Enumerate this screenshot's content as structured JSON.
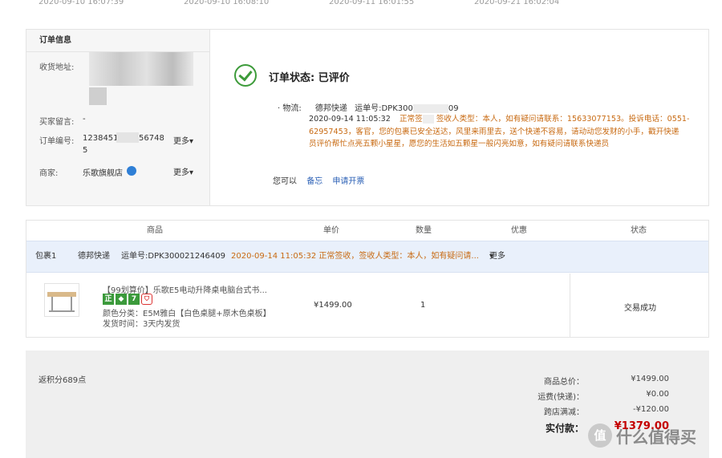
{
  "timeline": [
    "2020-09-10 16:07:39",
    "2020-09-10 16:08:10",
    "2020-09-11 16:01:55",
    "2020-09-21 16:02:04"
  ],
  "order_info": {
    "heading": "订单信息",
    "address_label": "收货地址:",
    "buyer_note_label": "买家留言:",
    "buyer_note": "-",
    "order_no_label": "订单编号:",
    "order_no_a": "1238451",
    "order_no_b": "56748",
    "order_no_c": "5",
    "more": "更多",
    "merchant_label": "商家:",
    "merchant": "乐歌旗舰店",
    "merchant_more": "更多"
  },
  "status": {
    "title": "订单状态: 已评价",
    "logistics_label": "· 物流:",
    "carrier": "德邦快递",
    "waybill_label": "运单号:DPK300",
    "waybill_tail": "09",
    "time": "2020-09-14 11:05:32",
    "detail_head": "正常签",
    "detail_a": "签收人类型：本人，如有疑问请联系：15633077153。投诉电话：0551-",
    "detail_b": "62957453，客官，您的包裹已安全送达，风里来雨里去，送个快递不容易，请动动您发财的小手，戳开快递",
    "detail_c": "员评价帮忙点亮五颗小星星，愿您的生活如五颗星一般闪亮如意，如有疑问请联系快递员",
    "you_can": "您可以",
    "action_note": "备忘",
    "action_invoice": "申请开票"
  },
  "goods": {
    "headers": [
      "商品",
      "单价",
      "数量",
      "优惠",
      "状态"
    ],
    "package": {
      "label": "包裹1",
      "carrier": "德邦快递",
      "waybill": "运单号:DPK300021246409",
      "info": "2020-09-14 11:05:32  正常签收，签收人类型：本人，如有疑问请...",
      "more": "更多"
    },
    "item": {
      "title": "【99划算价】乐歌E5电动升降桌电脑台式书...",
      "badges": [
        "正",
        "◆",
        "7",
        "⛉"
      ],
      "sku": "颜色分类：E5M雅白【白色桌腿+原木色桌板】 发货时间：3天内发货",
      "price": "¥1499.00",
      "qty": "1",
      "state": "交易成功"
    }
  },
  "summary": {
    "points": "返积分689点",
    "rows": [
      {
        "label": "商品总价：",
        "value": "¥1499.00"
      },
      {
        "label": "运费(快递)：",
        "value": "¥0.00"
      },
      {
        "label": "跨店满减：",
        "value": "-¥120.00"
      }
    ],
    "total_label": "实付款：",
    "total_value": "¥1379.00"
  },
  "watermark": {
    "icon": "值",
    "text": "什么值得买"
  },
  "colors": {
    "accent_orange": "#c86a12",
    "link_blue": "#2a5fb5",
    "success_green": "#3d9b3a",
    "total_red": "#c40000"
  }
}
